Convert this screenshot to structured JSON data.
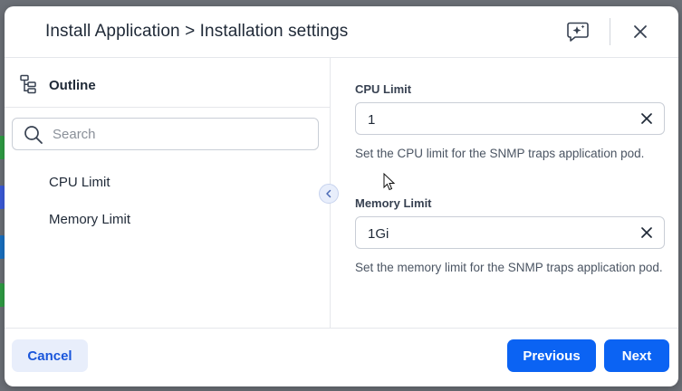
{
  "dialog": {
    "title": "Install Application > Installation settings"
  },
  "header": {
    "ai_icon": "sparkle-chat-icon",
    "close_icon": "close-icon"
  },
  "outline": {
    "label": "Outline",
    "icon": "outline-tree-icon",
    "search": {
      "placeholder": "Search",
      "value": ""
    },
    "items": [
      {
        "label": "CPU Limit"
      },
      {
        "label": "Memory Limit"
      }
    ]
  },
  "fields": [
    {
      "label": "CPU Limit",
      "value": "1",
      "help": "Set the CPU limit for the SNMP traps application pod."
    },
    {
      "label": "Memory Limit",
      "value": "1Gi",
      "help": "Set the memory limit for the SNMP traps application pod."
    }
  ],
  "footer": {
    "cancel_label": "Cancel",
    "previous_label": "Previous",
    "next_label": "Next"
  },
  "colors": {
    "primary": "#0b63f3",
    "secondary_bg": "#e8eefb"
  }
}
